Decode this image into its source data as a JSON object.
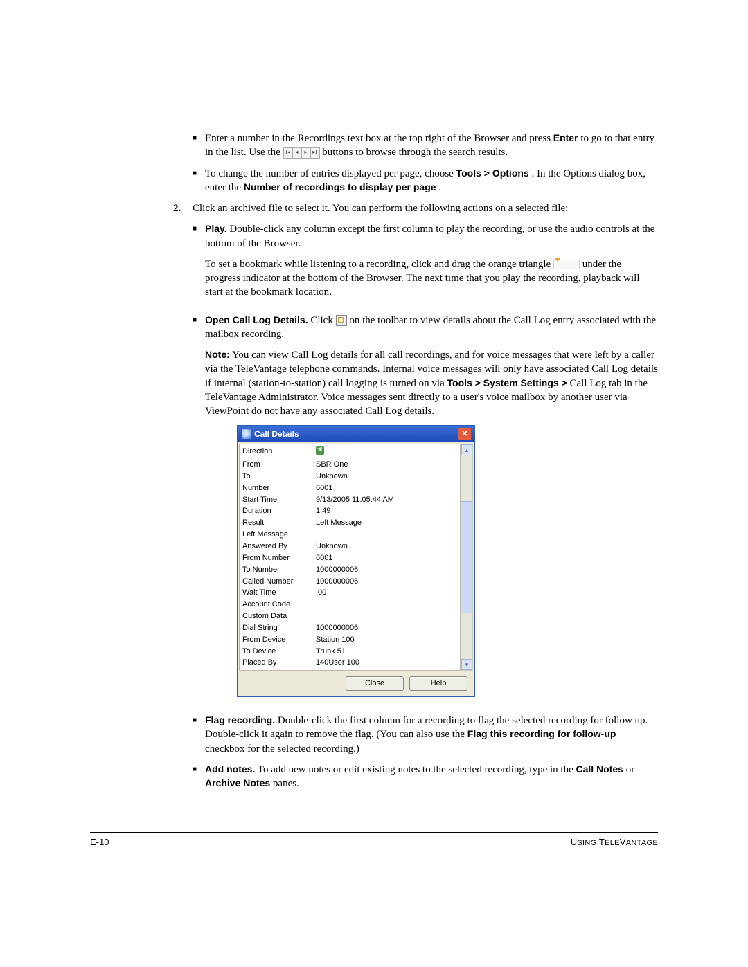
{
  "bullets1": {
    "b1_a": "Enter a number in the Recordings text box at the top right of the Browser and press ",
    "b1_enter": "Enter",
    "b1_b": " to go to that entry in the list. Use the ",
    "b1_c": " buttons to browse through the search results.",
    "b2_a": "To change the number of entries displayed per page, choose ",
    "b2_b": "Tools > Options",
    "b2_c": ". In the Options dialog box, enter the ",
    "b2_d": "Number of recordings to display per page",
    "b2_e": "."
  },
  "step2": {
    "num": "2.",
    "text": "Click an archived file to select it. You can perform the following actions on a selected file:"
  },
  "sub": {
    "play_l": "Play.",
    "play_t": " Double-click any column except the first column to play the recording, or use the audio controls at the bottom of the Browser.",
    "bm1": "To set a bookmark while listening to a recording, click and drag the orange triangle ",
    "bm2": " under the progress indicator at the bottom of the Browser. The next time that you play the recording, playback will start at the bookmark location.",
    "open_l": "Open Call Log Details.",
    "open_a": " Click ",
    "open_b": " on the toolbar to view details about the Call Log entry associated with the mailbox recording.",
    "note_l": "Note:",
    "note_t": " You can view Call Log details for all call recordings, and for voice messages that were left by a caller via the TeleVantage telephone commands. Internal voice messages will only have associated Call Log details if internal (station-to-station) call logging is turned on via ",
    "note_b": "Tools > System Settings >",
    "note_t2": " Call Log tab in the TeleVantage Administrator. Voice messages sent directly to a user's voice mailbox by another user via ViewPoint do not have any associated Call Log details.",
    "flag_l": "Flag recording.",
    "flag_t1": " Double-click the first column for a recording to flag the selected recording for follow up. Double-click it again to remove the flag. (You can also use the ",
    "flag_b": "Flag this recording for follow-up",
    "flag_t2": " checkbox for the selected recording.)",
    "add_l": "Add notes.",
    "add_t1": " To add new notes or edit existing notes to the selected recording, type in the ",
    "add_b1": "Call Notes",
    "add_t2": " or ",
    "add_b2": "Archive Notes",
    "add_t3": " panes."
  },
  "dialog": {
    "title": "Call Details",
    "close": "Close",
    "help": "Help",
    "rows": [
      {
        "label": "Direction",
        "value": ""
      },
      {
        "label": "From",
        "value": "SBR One"
      },
      {
        "label": "To",
        "value": "Unknown"
      },
      {
        "label": "Number",
        "value": "6001"
      },
      {
        "label": "Start Time",
        "value": "9/13/2005 11:05:44 AM"
      },
      {
        "label": "Duration",
        "value": "1:49"
      },
      {
        "label": "Result",
        "value": "Left Message"
      },
      {
        "label": "Left Message",
        "value": ""
      },
      {
        "label": "Answered By",
        "value": "Unknown"
      },
      {
        "label": "From Number",
        "value": "6001"
      },
      {
        "label": "To Number",
        "value": "1000000006"
      },
      {
        "label": "Called Number",
        "value": "1000000006"
      },
      {
        "label": "Wait Time",
        "value": ":00"
      },
      {
        "label": "Account Code",
        "value": ""
      },
      {
        "label": "Custom Data",
        "value": ""
      },
      {
        "label": "Dial String",
        "value": "1000000006"
      },
      {
        "label": "From Device",
        "value": "Station 100"
      },
      {
        "label": "To Device",
        "value": "Trunk 51"
      },
      {
        "label": "Placed By",
        "value": "140User 100"
      }
    ]
  },
  "footer": {
    "left": "E-10",
    "right_a": "U",
    "right_b": "SING ",
    "right_c": "T",
    "right_d": "ELE",
    "right_e": "V",
    "right_f": "ANTAGE"
  }
}
